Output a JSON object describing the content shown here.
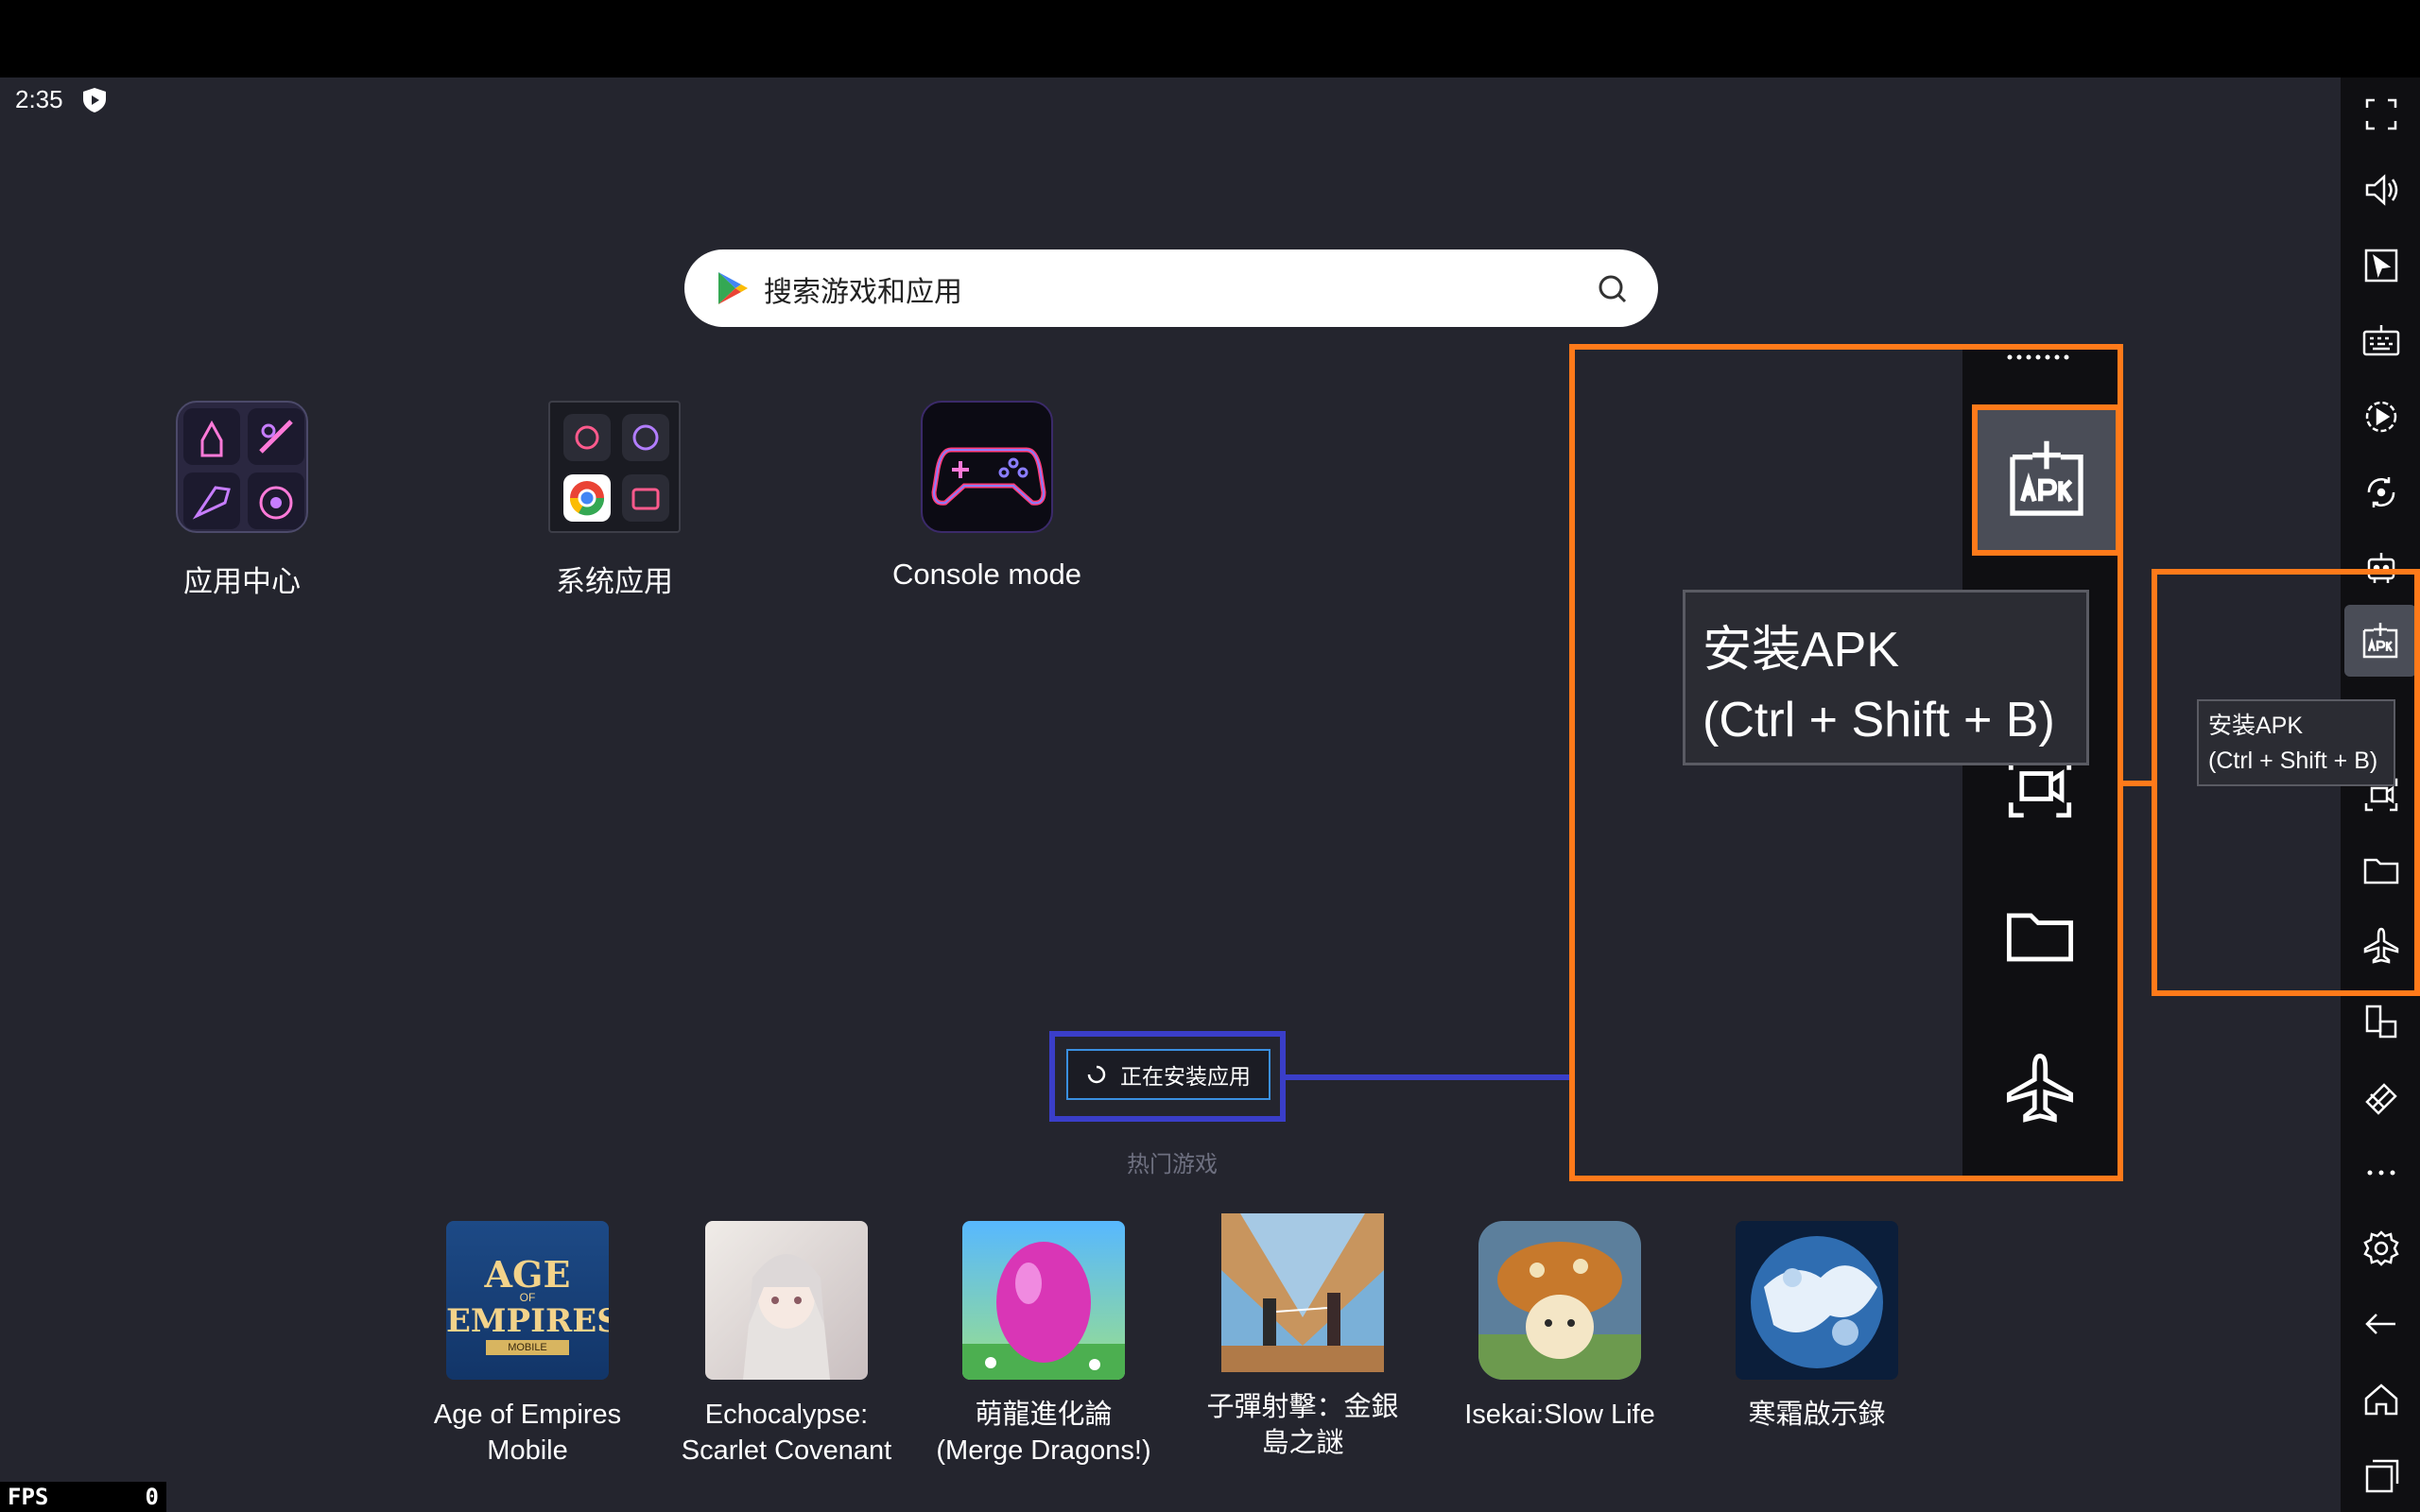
{
  "status_bar": {
    "time": "2:35",
    "shield_icon": "shield-play-icon"
  },
  "search": {
    "placeholder": "搜索游戏和应用",
    "left_icon": "google-play-icon",
    "right_icon": "search-icon"
  },
  "apps": [
    {
      "label": "应用中心",
      "icon": "app-center-icon"
    },
    {
      "label": "系统应用",
      "icon": "system-apps-folder-icon"
    },
    {
      "label": "Console mode",
      "icon": "gamepad-icon"
    }
  ],
  "installing": {
    "label": "正在安装应用",
    "icon": "spinner-icon"
  },
  "hot_games_label": "热门游戏",
  "games": [
    {
      "line1": "Age of Empires",
      "line2": "Mobile",
      "art_text_1": "AGE",
      "art_text_2": "OF",
      "art_text_3": "EMPIRES",
      "art_text_4": "MOBILE"
    },
    {
      "line1": "Echocalypse:",
      "line2": "Scarlet Covenant"
    },
    {
      "line1": "萌龍進化論",
      "line2": "(Merge Dragons!)"
    },
    {
      "line1": "子彈射擊：金銀",
      "line2": "島之謎"
    },
    {
      "line1": "Isekai:Slow Life",
      "line2": ""
    },
    {
      "line1": "寒霜啟示錄",
      "line2": ""
    }
  ],
  "sidebar": {
    "icons": [
      "fullscreen-icon",
      "volume-icon",
      "pointer-icon",
      "keyboard-icon",
      "macro-play-icon",
      "rotate-sync-icon",
      "robot-icon",
      "install-apk-icon",
      "screen-record-icon",
      "folder-icon",
      "airplane-icon",
      "multi-instance-icon",
      "eraser-icon",
      "more-icon",
      "settings-icon",
      "back-icon",
      "home-icon",
      "recents-icon"
    ]
  },
  "tooltip": {
    "line1": "安装APK",
    "line2": "(Ctrl + Shift + B)"
  },
  "fps": {
    "label": "FPS",
    "value": "0"
  },
  "colors": {
    "highlight_orange": "#ff7a1a",
    "highlight_blue": "#3a3ec9",
    "background": "#24252e"
  }
}
